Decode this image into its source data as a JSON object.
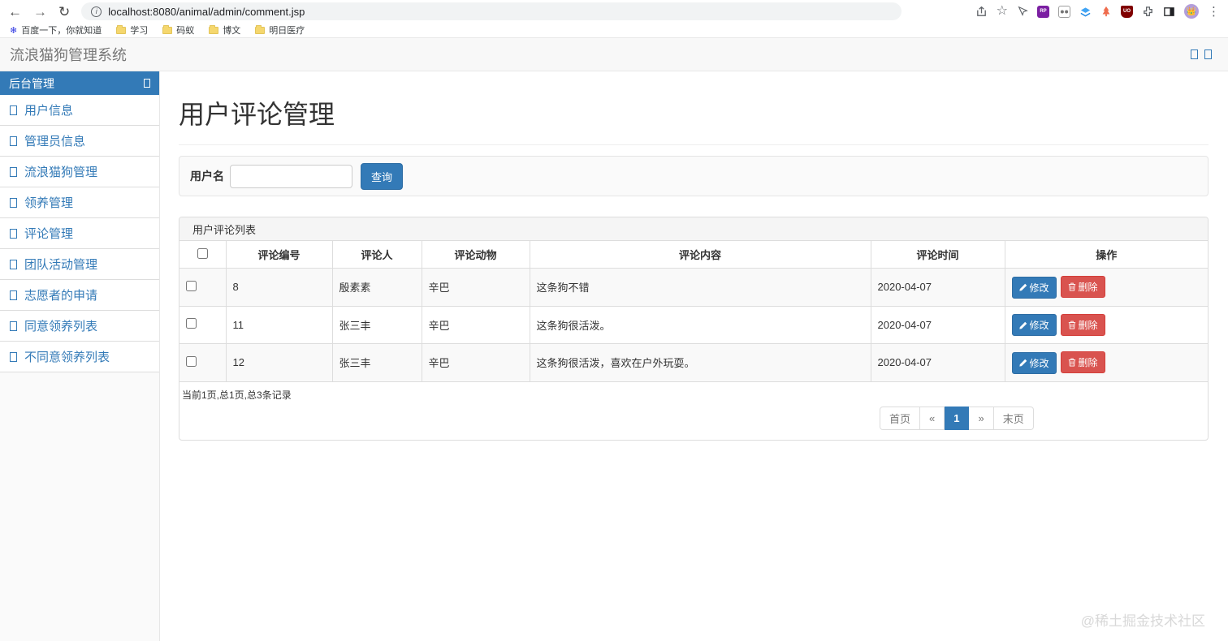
{
  "browser": {
    "url": "localhost:8080/animal/admin/comment.jsp",
    "bookmarks": [
      {
        "label": "百度一下，你就知道",
        "icon": "baidu-paw"
      },
      {
        "label": "学习",
        "icon": "folder"
      },
      {
        "label": "码蚁",
        "icon": "folder"
      },
      {
        "label": "博文",
        "icon": "folder"
      },
      {
        "label": "明日医疗",
        "icon": "folder"
      }
    ],
    "ext_badges": {
      "axure": "RP",
      "ublock": "UO"
    }
  },
  "navbar": {
    "title": "流浪猫狗管理系统"
  },
  "sidebar": {
    "header": "后台管理",
    "items": [
      {
        "label": "用户信息"
      },
      {
        "label": "管理员信息"
      },
      {
        "label": "流浪猫狗管理"
      },
      {
        "label": "领养管理"
      },
      {
        "label": "评论管理"
      },
      {
        "label": "团队活动管理"
      },
      {
        "label": "志愿者的申请"
      },
      {
        "label": "同意领养列表"
      },
      {
        "label": "不同意领养列表"
      }
    ]
  },
  "main": {
    "title": "用户评论管理",
    "search": {
      "label": "用户名",
      "button": "查询"
    },
    "panel": {
      "heading": "用户评论列表",
      "columns": {
        "id": "评论编号",
        "user": "评论人",
        "animal": "评论动物",
        "content": "评论内容",
        "time": "评论时间",
        "actions": "操作"
      },
      "rows": [
        {
          "id": "8",
          "user": "殷素素",
          "animal": "辛巴",
          "content": "这条狗不错",
          "time": "2020-04-07"
        },
        {
          "id": "11",
          "user": "张三丰",
          "animal": "辛巴",
          "content": "这条狗很活泼。",
          "time": "2020-04-07"
        },
        {
          "id": "12",
          "user": "张三丰",
          "animal": "辛巴",
          "content": "这条狗很活泼，喜欢在户外玩耍。",
          "time": "2020-04-07"
        }
      ],
      "edit_label": "修改",
      "delete_label": "删除",
      "pagination_info": "当前1页,总1页,总3条记录",
      "pager": {
        "first": "首页",
        "prev": "«",
        "page": "1",
        "next": "»",
        "last": "末页"
      }
    }
  },
  "watermark": "@稀土掘金技术社区",
  "colors": {
    "primary": "#337ab7",
    "danger": "#d9534f",
    "navbar_bg": "#f8f8f8",
    "stripe": "#f9f9f9"
  }
}
